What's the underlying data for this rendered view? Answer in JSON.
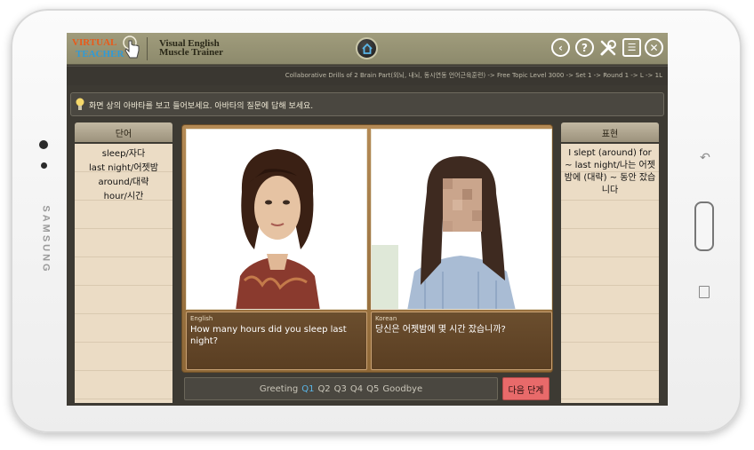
{
  "device": {
    "brand": "SAMSUNG"
  },
  "header": {
    "logo_line1": "VIRTUAL",
    "logo_line2": "TEACHER",
    "title_line1": "Visual English",
    "title_line2": "Muscle Trainer",
    "icons": [
      "home-icon",
      "back-icon",
      "help-icon",
      "settings-icon",
      "list-icon",
      "close-icon"
    ]
  },
  "breadcrumb": "Collaborative Drills of 2 Brain Part(외뇌, 내뇌, 동시연동 언어근육훈련) -> Free Topic Level 3000 -> Set 1 -> Round 1 -> L -> 1L",
  "instruction": "화면 상의 아바타를 보고 들어보세요. 아바타의 질문에 답해 보세요.",
  "words_panel": {
    "header": "단어",
    "items": [
      "sleep/자다",
      "last night/어젯밤",
      "around/대략",
      "hour/시간"
    ]
  },
  "expressions_panel": {
    "header": "표현",
    "text": "I slept (around) for ~ last night/나는 어젯밤에 (대략) ~ 동안 잤습니다"
  },
  "avatars": [
    {
      "language": "English",
      "text": "How many hours did you sleep last night?"
    },
    {
      "language": "Korean",
      "text": "당신은 어젯밤에 몇 시간 잤습니까?"
    }
  ],
  "progress": {
    "steps": [
      "Greeting",
      "Q1",
      "Q2",
      "Q3",
      "Q4",
      "Q5",
      "Goodbye"
    ],
    "active": "Q1"
  },
  "next_button": "다음 단계",
  "colors": {
    "accent_active_step": "#5ab6e8",
    "next_button": "#e86a6a",
    "logo_orange": "#e85a1a",
    "logo_blue": "#2e9bd8"
  }
}
